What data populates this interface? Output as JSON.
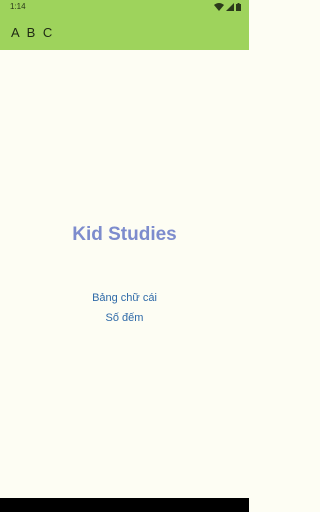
{
  "status_bar": {
    "time": "1:14",
    "icons": [
      "wifi-icon",
      "signal-icon",
      "battery-icon"
    ]
  },
  "app_bar": {
    "title": "A B C"
  },
  "main": {
    "title": "Kid Studies",
    "links": [
      {
        "label": "Bảng chữ cái"
      },
      {
        "label": "Số đếm"
      }
    ]
  },
  "colors": {
    "app_bar": "#9ed35c",
    "background": "#fdfdf3",
    "title": "#7d8ccd",
    "link": "#2f6aa8",
    "nav_bar": "#000000"
  }
}
